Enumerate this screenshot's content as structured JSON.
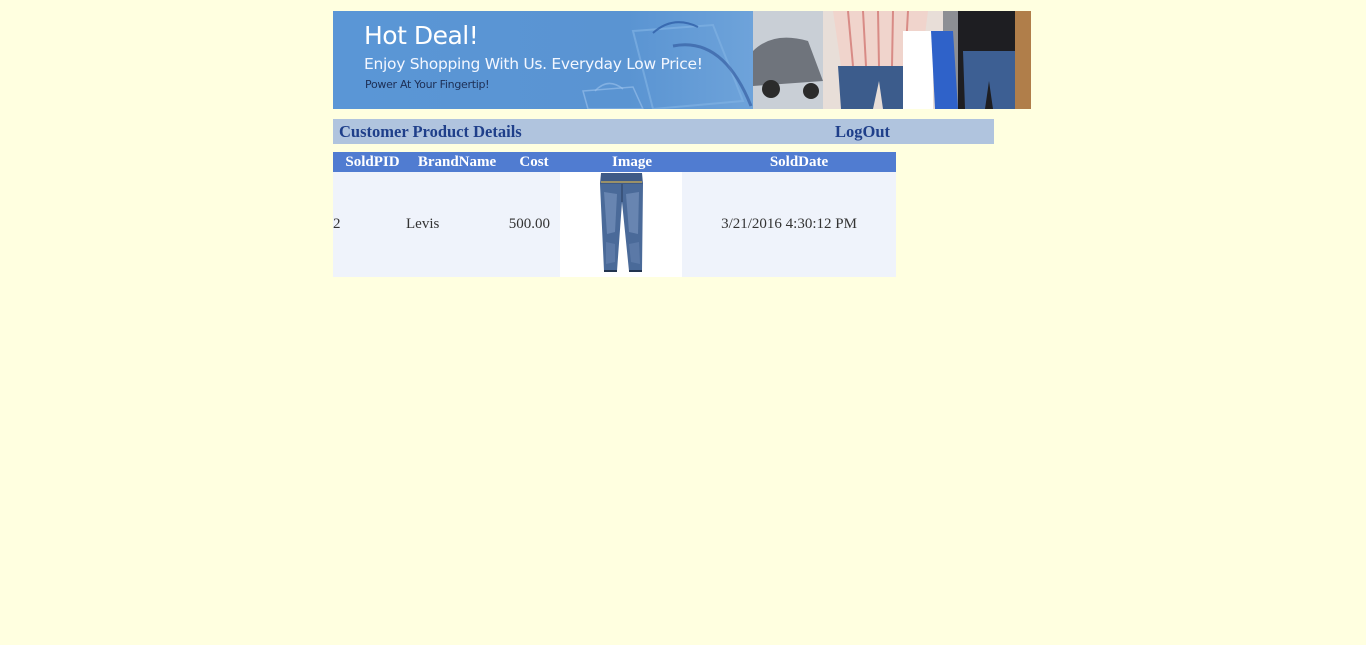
{
  "banner": {
    "title": "Hot Deal!",
    "subtitle": "Enjoy Shopping With Us. Everyday Low Price!",
    "tagline": "Power At Your Fingertip!"
  },
  "header": {
    "title": "Customer Product Details",
    "logout_label": "LogOut"
  },
  "table": {
    "columns": [
      "SoldPID",
      "BrandName",
      "Cost",
      "Image",
      "SoldDate"
    ],
    "rows": [
      {
        "sold_pid": "2",
        "brand_name": "Levis",
        "cost": "500.00",
        "image": "jeans-image",
        "sold_date": "3/21/2016 4:30:12 PM"
      }
    ]
  },
  "colors": {
    "page_bg": "#ffffe0",
    "header_bar_bg": "#b0c4de",
    "header_text": "#1f3f8a",
    "table_header_bg": "#507cd1",
    "row_bg": "#eff3fb"
  }
}
